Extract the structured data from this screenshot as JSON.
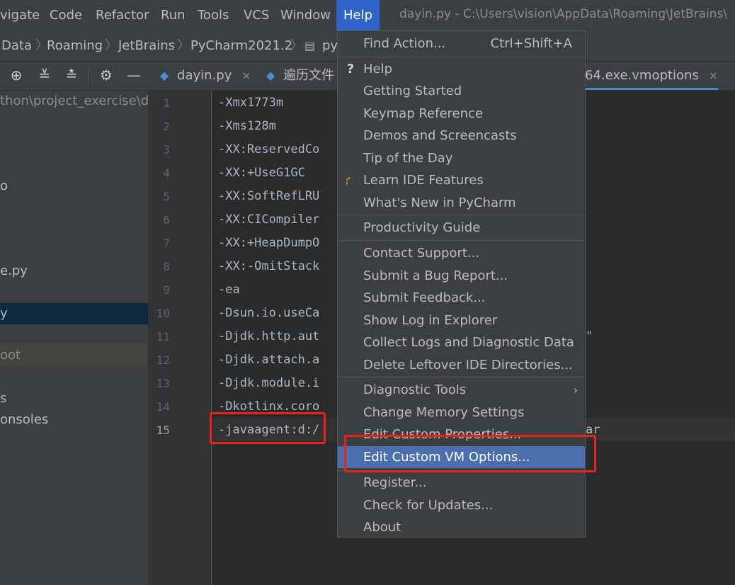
{
  "menubar": {
    "items": [
      "vigate",
      "Code",
      "Refactor",
      "Run",
      "Tools",
      "VCS",
      "Window",
      "Help"
    ],
    "title": "dayin.py - C:\\Users\\vision\\AppData\\Roaming\\JetBrains\\"
  },
  "breadcrumb": [
    "Data",
    "Roaming",
    "JetBrains",
    "PyCharm2021.2",
    "py"
  ],
  "project_path": "thon\\project_exercise\\da",
  "project_tree": [
    "o",
    "e.py",
    "y",
    "oot",
    "s",
    "onsoles"
  ],
  "tabs": [
    {
      "label": "dayin.py",
      "close": "×"
    },
    {
      "label": "遍历文件",
      "close": ""
    },
    {
      "label": "64.exe.vmoptions",
      "close": "×"
    }
  ],
  "editor": {
    "line_numbers": [
      "1",
      "2",
      "3",
      "4",
      "5",
      "6",
      "7",
      "8",
      "9",
      "10",
      "11",
      "12",
      "13",
      "14",
      "15"
    ],
    "lines": [
      "-Xmx1773m",
      "-Xms128m",
      "-XX:ReservedCo",
      "-XX:+UseG1GC",
      "-XX:SoftRefLRU",
      "-XX:CICompiler",
      "-XX:+HeapDumpO",
      "-XX:-OmitStack",
      "-ea",
      "-Dsun.io.useCa",
      "-Djdk.http.aut",
      "-Djdk.attach.a",
      "-Djdk.module.i",
      "-Dkotlinx.coro",
      "-javaagent:d:/"
    ],
    "right_fragments": {
      "line11": "\"",
      "line15": "ar"
    }
  },
  "help_menu": {
    "find_action": {
      "label": "Find Action...",
      "shortcut": "Ctrl+Shift+A"
    },
    "group1": [
      {
        "label": "Help",
        "icon": "?"
      },
      {
        "label": "Getting Started"
      },
      {
        "label": "Keymap Reference"
      },
      {
        "label": "Demos and Screencasts"
      },
      {
        "label": "Tip of the Day"
      },
      {
        "label": "Learn IDE Features",
        "icon": "🎓"
      },
      {
        "label": "What's New in PyCharm"
      }
    ],
    "group2": [
      {
        "label": "Productivity Guide"
      }
    ],
    "group3": [
      {
        "label": "Contact Support..."
      },
      {
        "label": "Submit a Bug Report..."
      },
      {
        "label": "Submit Feedback..."
      },
      {
        "label": "Show Log in Explorer"
      },
      {
        "label": "Collect Logs and Diagnostic Data"
      },
      {
        "label": "Delete Leftover IDE Directories..."
      }
    ],
    "group4": [
      {
        "label": "Diagnostic Tools",
        "arrow": "›"
      },
      {
        "label": "Change Memory Settings"
      },
      {
        "label": "Edit Custom Properties..."
      },
      {
        "label": "Edit Custom VM Options..."
      }
    ],
    "group5": [
      {
        "label": "Register..."
      },
      {
        "label": "Check for Updates..."
      },
      {
        "label": "About"
      }
    ]
  },
  "colors": {
    "highlight": "#4b6eaf",
    "annotation": "#e8231b",
    "active_menu": "#2f65ca"
  }
}
